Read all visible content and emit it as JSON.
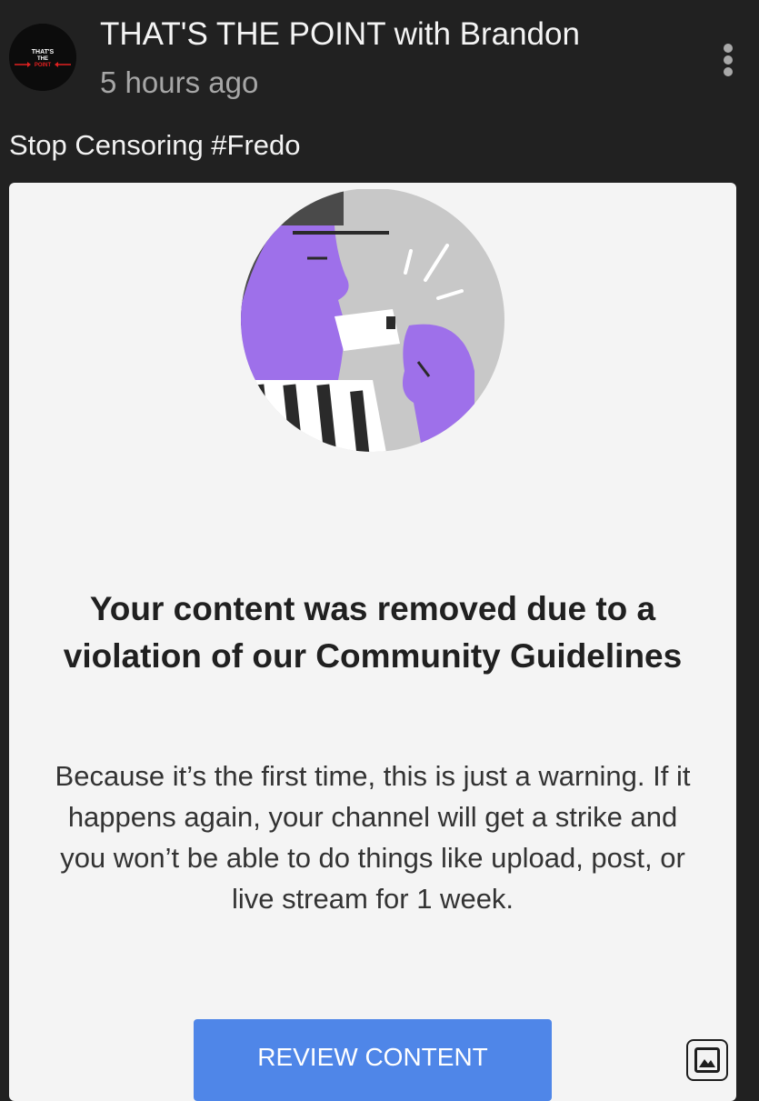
{
  "post": {
    "channel_name": "THAT'S THE POINT with Brandon",
    "timestamp": "5 hours ago",
    "text": "Stop Censoring #Fredo",
    "avatar_logo": {
      "line1": "THAT'S",
      "line2": "THE",
      "line3": "POINT"
    },
    "menu_icon": "more-vertical-icon"
  },
  "notice": {
    "illustration": "referee-whistle-illustration",
    "headline": "Your content was removed due to a violation of our Community Guidelines",
    "body": "Because it’s the first time, this is just a warning. If it happens again, your channel will get a strike and you won’t be able to do things like upload, post, or live stream for 1 week.",
    "button_label": "REVIEW CONTENT"
  },
  "overlay": {
    "icon": "image-icon"
  },
  "colors": {
    "background": "#212121",
    "card": "#f4f4f4",
    "button": "#4f86e8",
    "illustration_purple": "#9e70ea",
    "avatar_red": "#e02020"
  }
}
